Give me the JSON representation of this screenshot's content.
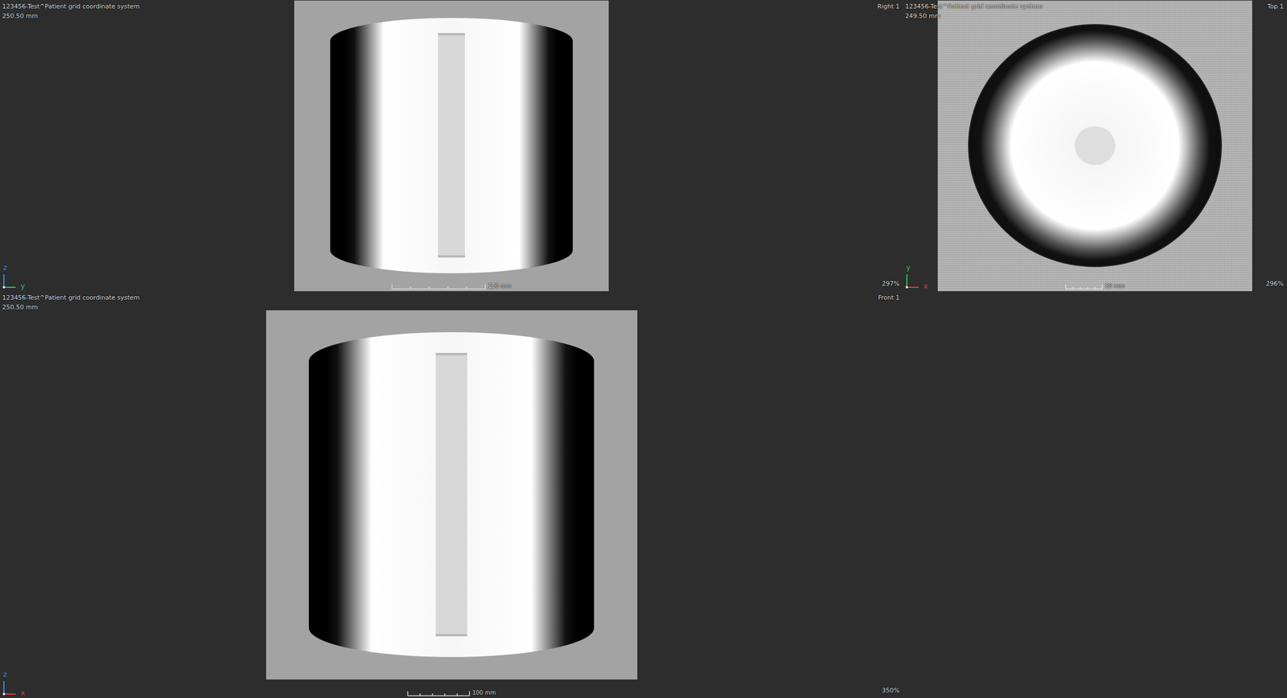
{
  "viewports": [
    {
      "kind": "side",
      "name": "Right 1",
      "title": "123456-Test^Patient grid coordinate system",
      "size": "250.50 mm",
      "zoom": "297%",
      "scale": "150 mm",
      "scale_level": 0.3,
      "axes": [
        {
          "label": "z",
          "color": "#3a8ee6"
        },
        {
          "label": "y",
          "color": "#2fbf5a"
        }
      ]
    },
    {
      "kind": "top",
      "name": "Top 1",
      "title": "123456-Test^Patient grid coordinate system",
      "size": "249.50 mm",
      "zoom": "296%",
      "scale": "60 mm",
      "scale_level": 0.12,
      "axes": [
        {
          "label": "y",
          "color": "#2fbf5a"
        },
        {
          "label": "x",
          "color": "#e0403a"
        }
      ]
    },
    {
      "kind": "side",
      "name": "Front 1",
      "title": "123456-Test^Patient grid coordinate system",
      "size": "250.50 mm",
      "zoom": "350%",
      "scale": "100 mm",
      "scale_level": 0.2,
      "axes": [
        {
          "label": "z",
          "color": "#3a8ee6"
        },
        {
          "label": "x",
          "color": "#e0403a"
        }
      ]
    }
  ]
}
